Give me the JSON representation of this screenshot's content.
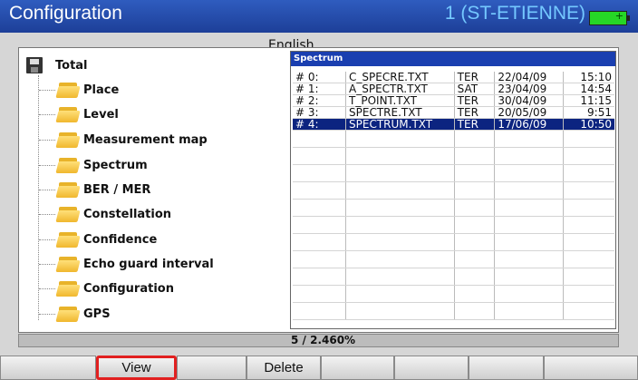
{
  "titlebar": {
    "title": "Configuration",
    "site": "1 (ST-ETIENNE)",
    "battery_icon": "battery-full-icon",
    "battery_color": "#26d626"
  },
  "partial_label": "English",
  "tree": {
    "root": {
      "label": "Total",
      "icon": "floppy-disk-icon"
    },
    "items": [
      {
        "label": "Place",
        "icon": "folder-icon"
      },
      {
        "label": "Level",
        "icon": "folder-icon"
      },
      {
        "label": "Measurement map",
        "icon": "folder-icon"
      },
      {
        "label": "Spectrum",
        "icon": "folder-icon"
      },
      {
        "label": "BER / MER",
        "icon": "folder-icon"
      },
      {
        "label": "Constellation",
        "icon": "folder-icon"
      },
      {
        "label": "Confidence",
        "icon": "folder-icon"
      },
      {
        "label": "Echo guard interval",
        "icon": "folder-icon"
      },
      {
        "label": "Configuration",
        "icon": "folder-icon"
      },
      {
        "label": "GPS",
        "icon": "folder-icon"
      }
    ]
  },
  "file_list": {
    "header": "Spectrum",
    "rows": [
      {
        "index": "#  0:",
        "file": "C_SPECRE.TXT",
        "type": "TER",
        "date": "22/04/09",
        "time": "15:10"
      },
      {
        "index": "#  1:",
        "file": "A_SPECTR.TXT",
        "type": "SAT",
        "date": "23/04/09",
        "time": "14:54"
      },
      {
        "index": "#  2:",
        "file": "T_POINT.TXT",
        "type": "TER",
        "date": "30/04/09",
        "time": "11:15"
      },
      {
        "index": "#  3:",
        "file": "SPECTRE.TXT",
        "type": "TER",
        "date": "20/05/09",
        "time": "9:51"
      },
      {
        "index": "#  4:",
        "file": "SPECTRUM.TXT",
        "type": "TER",
        "date": "17/06/09",
        "time": "10:50"
      }
    ],
    "selected_index": 4,
    "selected_color": "#0c2480"
  },
  "status": "5 /  2.460%",
  "softkeys": {
    "view": "View",
    "delete": "Delete",
    "selected_color": "#e12020"
  }
}
